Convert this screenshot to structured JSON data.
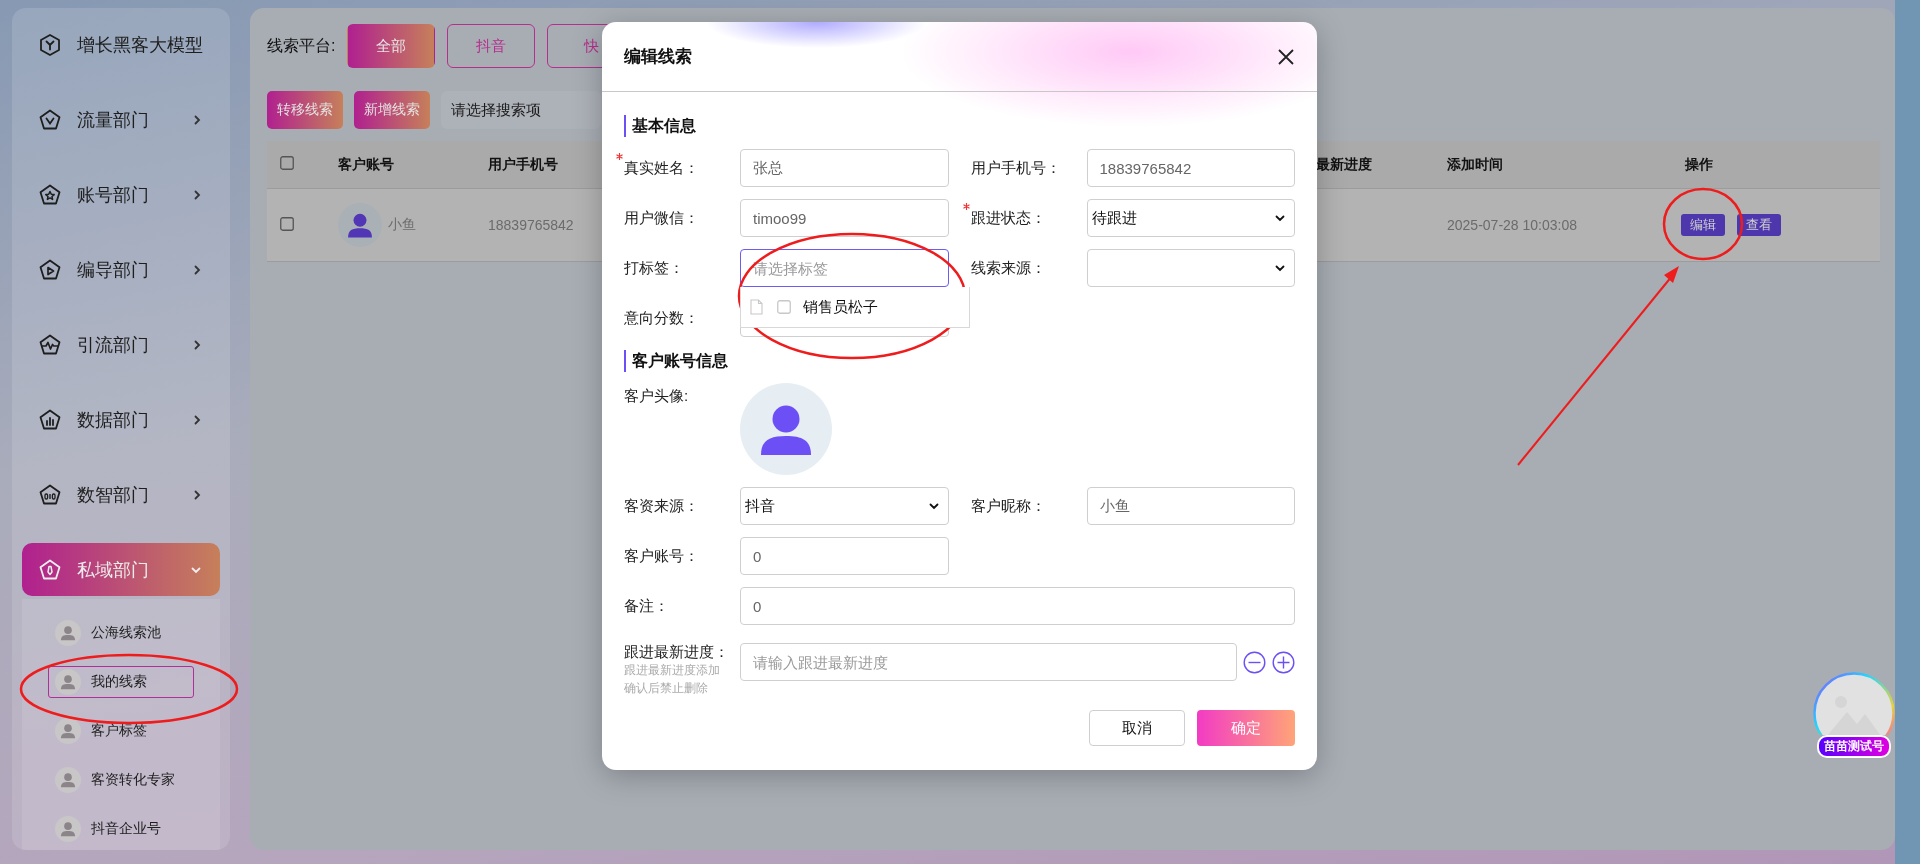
{
  "sidebar": {
    "items": [
      {
        "kind": "link",
        "label": "增长黑客大模型",
        "selected": false,
        "expanded": false
      },
      {
        "kind": "group",
        "label": "流量部门",
        "selected": false,
        "expanded": false
      },
      {
        "kind": "group",
        "label": "账号部门",
        "selected": false,
        "expanded": false
      },
      {
        "kind": "group",
        "label": "编导部门",
        "selected": false,
        "expanded": false
      },
      {
        "kind": "group",
        "label": "引流部门",
        "selected": false,
        "expanded": false
      },
      {
        "kind": "group",
        "label": "数据部门",
        "selected": false,
        "expanded": false
      },
      {
        "kind": "group",
        "label": "数智部门",
        "selected": false,
        "expanded": false
      },
      {
        "kind": "group",
        "label": "私域部门",
        "selected": true,
        "expanded": true,
        "children": [
          {
            "label": "公海线索池",
            "selected": false
          },
          {
            "label": "我的线索",
            "selected": true
          },
          {
            "label": "客户标签",
            "selected": false
          },
          {
            "label": "客资转化专家",
            "selected": false
          },
          {
            "label": "抖音企业号",
            "selected": false
          }
        ]
      }
    ]
  },
  "filter": {
    "label": "线索平台:",
    "platforms": [
      {
        "label": "全部",
        "selected": true
      },
      {
        "label": "抖音",
        "selected": false
      },
      {
        "label": "快",
        "selected": false
      }
    ]
  },
  "toolbar": {
    "buttons": [
      "转移线索",
      "新增线索"
    ],
    "search_select": {
      "placeholder": "请选择搜索项"
    }
  },
  "table": {
    "all_checked": false,
    "columns": [
      "客户账号",
      "用户手机号",
      "最新进度",
      "添加时间",
      "操作"
    ],
    "rows": [
      {
        "checked": false,
        "account": "小鱼",
        "phone": "18839765842",
        "progress": "",
        "added": "2025-07-28 10:03:08",
        "actions": [
          "编辑",
          "查看"
        ]
      }
    ]
  },
  "dialog": {
    "title": "编辑线索",
    "basic": {
      "title": "基本信息",
      "fields": [
        {
          "kind": "text",
          "label": "真实姓名：",
          "required": true,
          "value": "张总"
        },
        {
          "kind": "text",
          "label": "用户手机号：",
          "required": false,
          "value": "18839765842"
        },
        {
          "kind": "text",
          "label": "用户微信：",
          "required": false,
          "value": "timoo99"
        },
        {
          "kind": "select",
          "label": "跟进状态：",
          "required": true,
          "value": "待跟进"
        },
        {
          "kind": "tags",
          "label": "打标签：",
          "required": false,
          "placeholder": "请选择标签",
          "focused": true,
          "options": [
            {
              "label": "销售员松子",
              "checked": false
            }
          ]
        },
        {
          "kind": "select",
          "label": "线索来源：",
          "required": false
        },
        {
          "kind": "text",
          "label": "意向分数：",
          "required": false
        }
      ]
    },
    "account": {
      "title": "客户账号信息",
      "avatar_label": "客户头像:",
      "fields": [
        {
          "kind": "select",
          "label": "客资来源：",
          "required": false,
          "value": "抖音"
        },
        {
          "kind": "text",
          "label": "客户昵称：",
          "required": false,
          "value": "小鱼"
        },
        {
          "kind": "text",
          "label": "客户账号：",
          "required": false,
          "value": "0"
        },
        {
          "kind": "wide",
          "label": "备注：",
          "required": false,
          "value": "0"
        }
      ]
    },
    "progress": {
      "label": "跟进最新进度：",
      "hint": "跟进最新进度添加确认后禁止删除",
      "placeholder": "请输入跟进最新进度"
    },
    "buttons": [
      {
        "kind": "secondary",
        "label": "取消"
      },
      {
        "kind": "primary",
        "label": "确定"
      }
    ]
  },
  "floating_account": {
    "label": "苗苗测试号"
  }
}
